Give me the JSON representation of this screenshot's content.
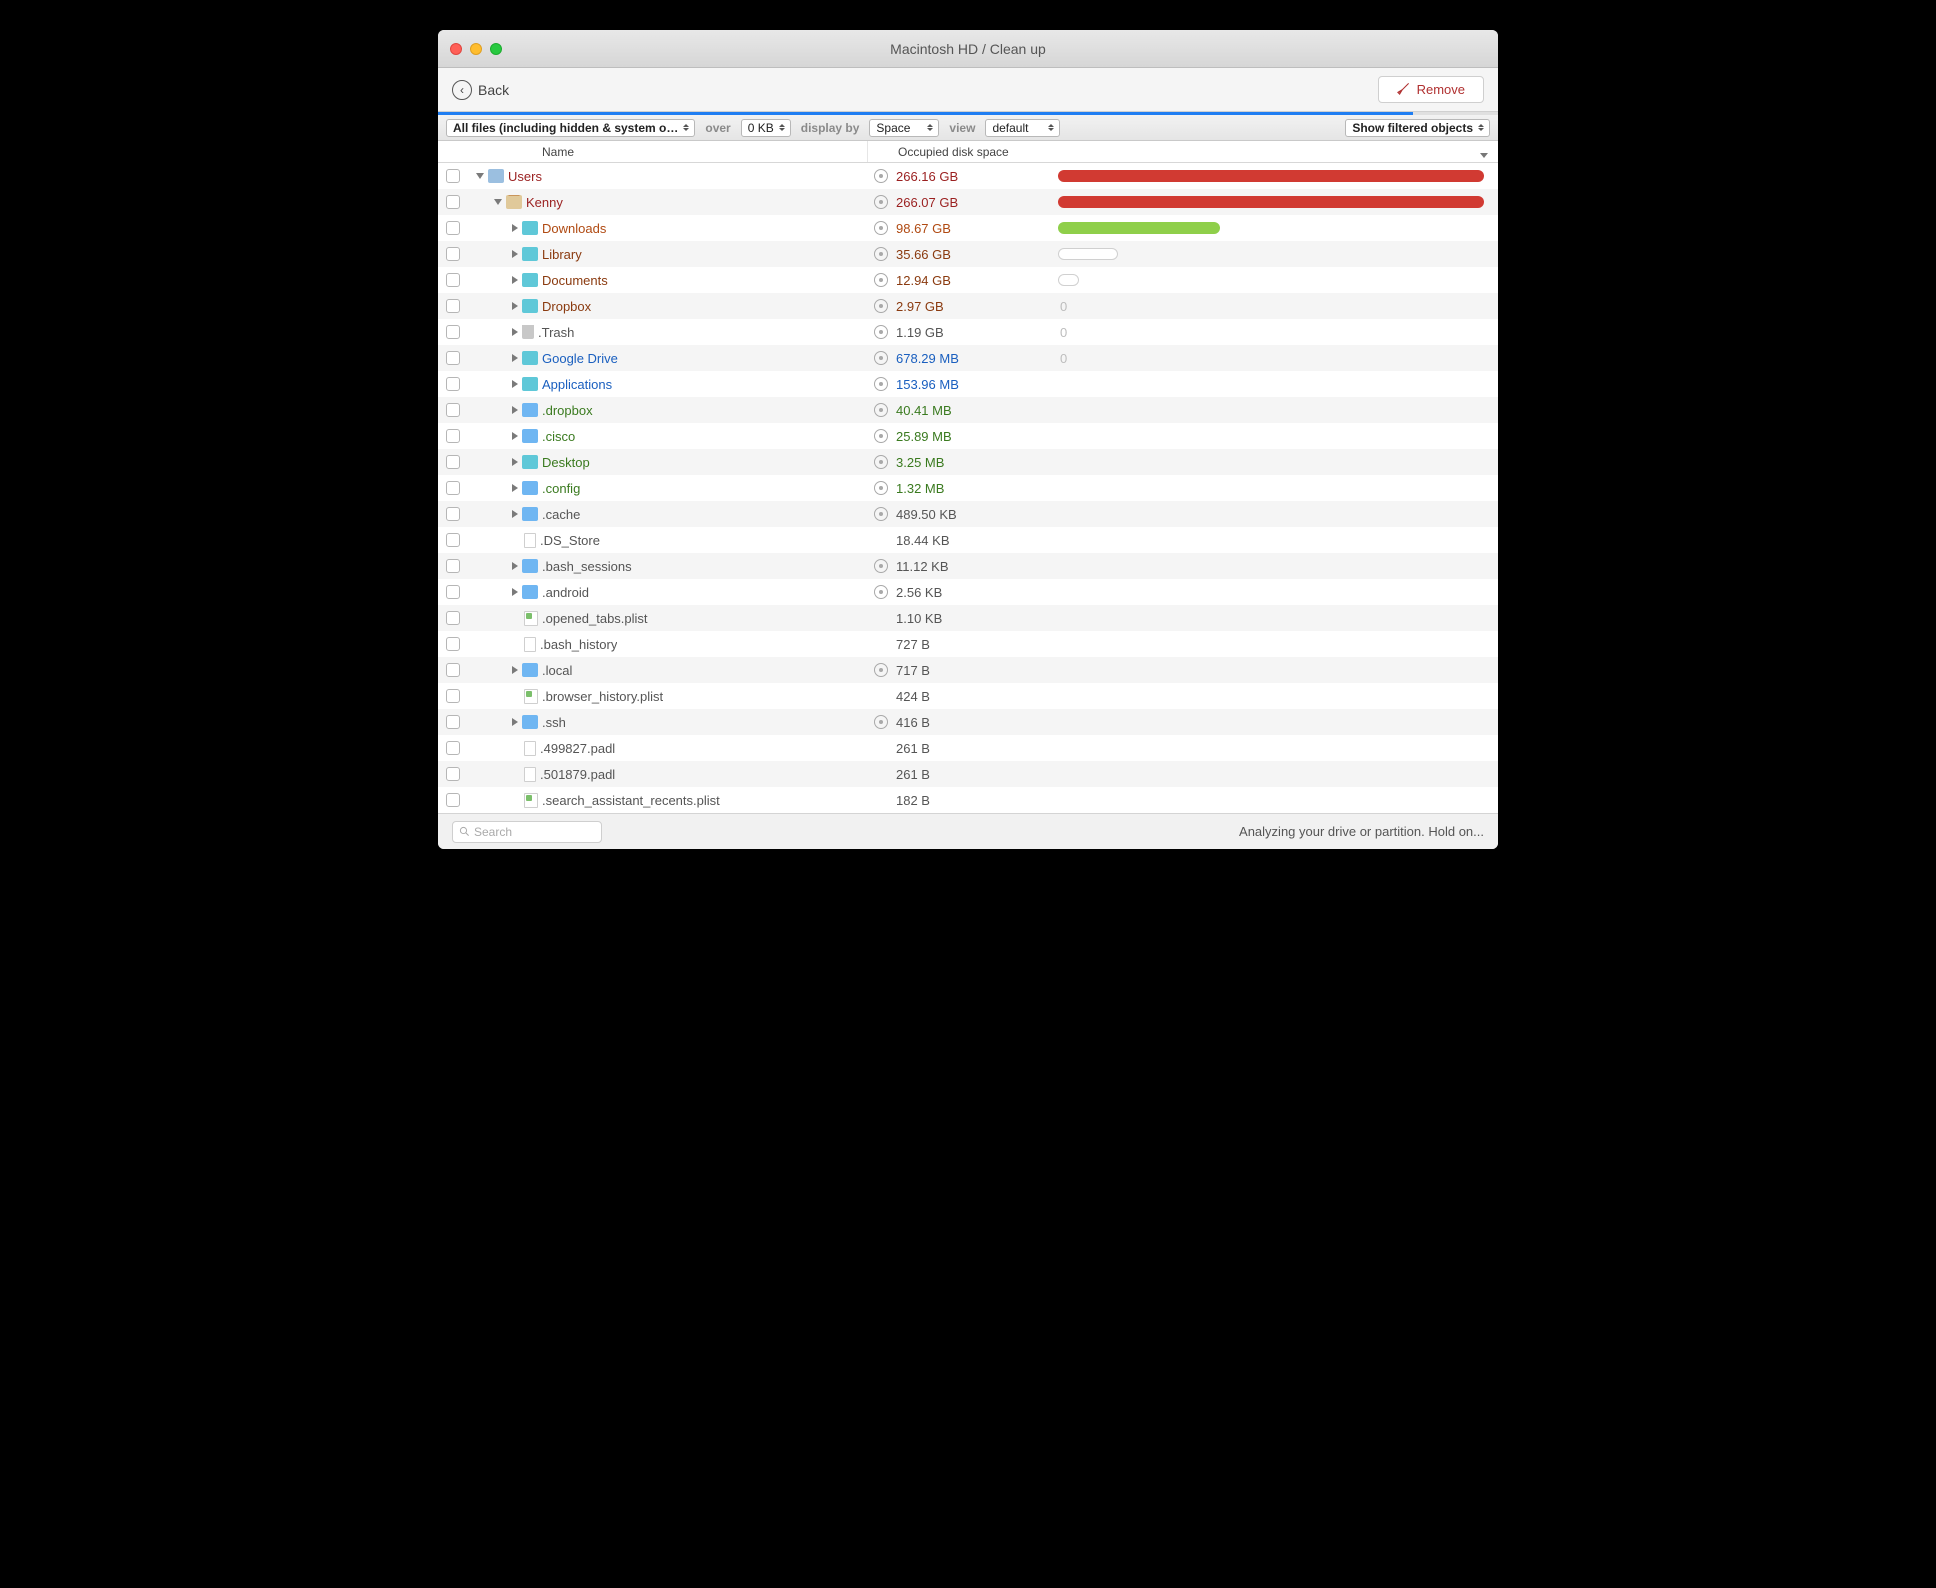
{
  "window": {
    "title": "Macintosh HD / Clean up"
  },
  "toolbar": {
    "back_label": "Back",
    "remove_label": "Remove"
  },
  "filterbar": {
    "scope": "All files (including hidden & system o…",
    "over_label": "over",
    "over_value": "0 KB",
    "display_label": "display by",
    "display_value": "Space",
    "view_label": "view",
    "view_value": "default",
    "filtered_label": "Show filtered objects"
  },
  "columns": {
    "name": "Name",
    "space": "Occupied disk space"
  },
  "rows": [
    {
      "indent": 0,
      "expand": "open",
      "icon": "folder-sys",
      "name": "Users",
      "size": "266.16 GB",
      "ql": true,
      "color": "red",
      "bar": {
        "type": "fill",
        "color": "#d13a32",
        "pct": 100
      }
    },
    {
      "indent": 1,
      "expand": "open",
      "icon": "home",
      "name": "Kenny",
      "size": "266.07 GB",
      "ql": true,
      "color": "red",
      "bar": {
        "type": "fill",
        "color": "#d13a32",
        "pct": 100
      }
    },
    {
      "indent": 2,
      "expand": "closed",
      "icon": "folder-teal",
      "name": "Downloads",
      "size": "98.67 GB",
      "ql": true,
      "color": "orange",
      "bar": {
        "type": "fill",
        "color": "#8fcf4a",
        "pct": 38
      }
    },
    {
      "indent": 2,
      "expand": "closed",
      "icon": "folder-teal",
      "name": "Library",
      "size": "35.66 GB",
      "ql": true,
      "color": "brown",
      "bar": {
        "type": "outline",
        "pct": 14
      }
    },
    {
      "indent": 2,
      "expand": "closed",
      "icon": "folder-teal",
      "name": "Documents",
      "size": "12.94 GB",
      "ql": true,
      "color": "brown",
      "bar": {
        "type": "outline",
        "pct": 5
      }
    },
    {
      "indent": 2,
      "expand": "closed",
      "icon": "folder-teal",
      "name": "Dropbox",
      "size": "2.97 GB",
      "ql": true,
      "color": "brown",
      "bar": {
        "type": "zero"
      }
    },
    {
      "indent": 2,
      "expand": "closed",
      "icon": "trash",
      "name": ".Trash",
      "size": "1.19 GB",
      "ql": true,
      "color": "gray",
      "bar": {
        "type": "zero"
      }
    },
    {
      "indent": 2,
      "expand": "closed",
      "icon": "folder-teal",
      "name": "Google Drive",
      "size": "678.29 MB",
      "ql": true,
      "color": "blue",
      "bar": {
        "type": "zero"
      }
    },
    {
      "indent": 2,
      "expand": "closed",
      "icon": "folder-teal",
      "name": "Applications",
      "size": "153.96 MB",
      "ql": true,
      "color": "blue",
      "bar": {
        "type": "none"
      }
    },
    {
      "indent": 2,
      "expand": "closed",
      "icon": "folder",
      "name": ".dropbox",
      "size": "40.41 MB",
      "ql": true,
      "color": "green",
      "bar": {
        "type": "none"
      }
    },
    {
      "indent": 2,
      "expand": "closed",
      "icon": "folder",
      "name": ".cisco",
      "size": "25.89 MB",
      "ql": true,
      "color": "green",
      "bar": {
        "type": "none"
      }
    },
    {
      "indent": 2,
      "expand": "closed",
      "icon": "folder-teal",
      "name": "Desktop",
      "size": "3.25 MB",
      "ql": true,
      "color": "green",
      "bar": {
        "type": "none"
      }
    },
    {
      "indent": 2,
      "expand": "closed",
      "icon": "folder",
      "name": ".config",
      "size": "1.32 MB",
      "ql": true,
      "color": "green",
      "bar": {
        "type": "none"
      }
    },
    {
      "indent": 2,
      "expand": "closed",
      "icon": "folder",
      "name": ".cache",
      "size": "489.50 KB",
      "ql": true,
      "color": "gray",
      "bar": {
        "type": "none"
      }
    },
    {
      "indent": 2,
      "expand": "none",
      "icon": "file",
      "name": ".DS_Store",
      "size": "18.44 KB",
      "ql": false,
      "color": "gray",
      "bar": {
        "type": "none"
      }
    },
    {
      "indent": 2,
      "expand": "closed",
      "icon": "folder",
      "name": ".bash_sessions",
      "size": "11.12 KB",
      "ql": true,
      "color": "gray",
      "bar": {
        "type": "none"
      }
    },
    {
      "indent": 2,
      "expand": "closed",
      "icon": "folder",
      "name": ".android",
      "size": "2.56 KB",
      "ql": true,
      "color": "gray",
      "bar": {
        "type": "none"
      }
    },
    {
      "indent": 2,
      "expand": "none",
      "icon": "plist",
      "name": ".opened_tabs.plist",
      "size": "1.10 KB",
      "ql": false,
      "color": "gray",
      "bar": {
        "type": "none"
      }
    },
    {
      "indent": 2,
      "expand": "none",
      "icon": "file",
      "name": ".bash_history",
      "size": "727 B",
      "ql": false,
      "color": "gray",
      "bar": {
        "type": "none"
      }
    },
    {
      "indent": 2,
      "expand": "closed",
      "icon": "folder",
      "name": ".local",
      "size": "717 B",
      "ql": true,
      "color": "gray",
      "bar": {
        "type": "none"
      }
    },
    {
      "indent": 2,
      "expand": "none",
      "icon": "plist",
      "name": ".browser_history.plist",
      "size": "424 B",
      "ql": false,
      "color": "gray",
      "bar": {
        "type": "none"
      }
    },
    {
      "indent": 2,
      "expand": "closed",
      "icon": "folder",
      "name": ".ssh",
      "size": "416 B",
      "ql": true,
      "color": "gray",
      "bar": {
        "type": "none"
      }
    },
    {
      "indent": 2,
      "expand": "none",
      "icon": "file",
      "name": ".499827.padl",
      "size": "261 B",
      "ql": false,
      "color": "gray",
      "bar": {
        "type": "none"
      }
    },
    {
      "indent": 2,
      "expand": "none",
      "icon": "file",
      "name": ".501879.padl",
      "size": "261 B",
      "ql": false,
      "color": "gray",
      "bar": {
        "type": "none"
      }
    },
    {
      "indent": 2,
      "expand": "none",
      "icon": "plist",
      "name": ".search_assistant_recents.plist",
      "size": "182 B",
      "ql": false,
      "color": "gray",
      "bar": {
        "type": "none"
      }
    }
  ],
  "status": {
    "search_placeholder": "Search",
    "message": "Analyzing your drive or partition. Hold on..."
  }
}
